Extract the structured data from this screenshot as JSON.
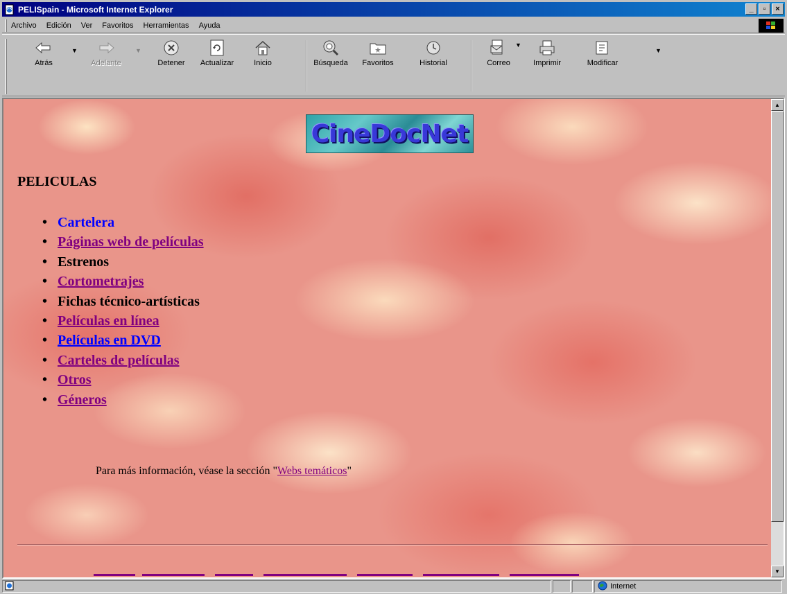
{
  "window": {
    "title": "PELISpain - Microsoft Internet Explorer",
    "controls": {
      "minimize": "_",
      "maximize": "▫",
      "close": "×"
    }
  },
  "menu": [
    "Archivo",
    "Edición",
    "Ver",
    "Favoritos",
    "Herramientas",
    "Ayuda"
  ],
  "toolbar": {
    "back": "Atrás",
    "forward": "Adelante",
    "stop": "Detener",
    "refresh": "Actualizar",
    "home": "Inicio",
    "search": "Búsqueda",
    "favorites": "Favoritos",
    "history": "Historial",
    "mail": "Correo",
    "print": "Imprimir",
    "edit": "Modificar"
  },
  "page": {
    "logo_text": "CineDocNet",
    "heading": "PELICULAS",
    "items": [
      "Cartelera",
      "Páginas web de películas",
      "Estrenos",
      "Cortometrajes",
      "Fichas técnico-artísticas",
      "Películas en línea",
      "Películas en DVD",
      "Carteles de películas",
      "Otros",
      "Géneros"
    ],
    "info_prefix": "Para más información, véase la sección \"",
    "info_link": "Webs temáticos",
    "info_suffix": "\""
  },
  "status": {
    "zone": "Internet"
  },
  "colors": {
    "link": "#0000ff",
    "visited": "#800080",
    "title_bar": "#000080"
  }
}
